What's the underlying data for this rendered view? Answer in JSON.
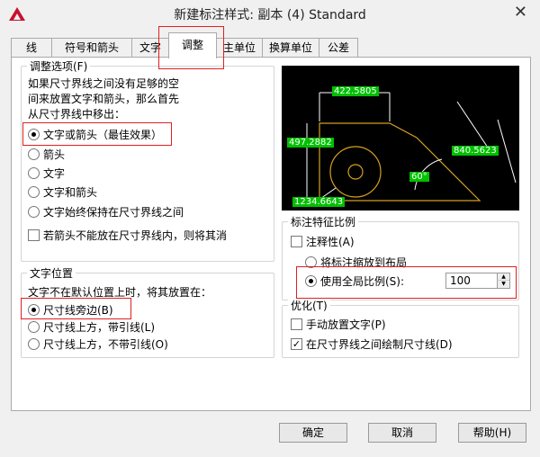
{
  "window": {
    "title": "新建标注样式: 副本 (4) Standard",
    "close_glyph": "✕",
    "logo": "autocad-logo"
  },
  "tabs": [
    "线",
    "符号和箭头",
    "文字",
    "调整",
    "主单位",
    "换算单位",
    "公差"
  ],
  "fit_options": {
    "title": "调整选项(F)",
    "description": [
      "如果尺寸界线之间没有足够的空",
      "间来放置文字和箭头，那么首先",
      "从尺寸界线中移出："
    ],
    "options": [
      "文字或箭头（最佳效果）",
      "箭头",
      "文字",
      "文字和箭头",
      "文字始终保持在尺寸界线之间"
    ],
    "selected": 0,
    "suppress_label": "若箭头不能放在尺寸界线内，则将其消"
  },
  "text_placement": {
    "title": "文字位置",
    "description": "文字不在默认位置上时，将其放置在：",
    "options": [
      "尺寸线旁边(B)",
      "尺寸线上方，带引线(L)",
      "尺寸线上方，不带引线(O)"
    ],
    "selected": 0
  },
  "preview": {
    "labels": [
      "422.5805",
      "497.2882",
      "840.5623",
      "60°",
      "1234.6643"
    ],
    "colors": {
      "background": "#000000",
      "label_bg": "#00c000",
      "geometry": "#d4a020",
      "lines": "#ffffff"
    }
  },
  "scale": {
    "title": "标注特征比例",
    "annotative_label": "注释性(A)",
    "layout_option": "将标注缩放到布局",
    "global_option": "使用全局比例(S):",
    "global_value": "100"
  },
  "finetune": {
    "title": "优化(T)",
    "manual_label": "手动放置文字(P)",
    "manual_checked": false,
    "draw_label": "在尺寸界线之间绘制尺寸线(D)",
    "draw_checked": true
  },
  "buttons": {
    "ok": "确定",
    "cancel": "取消",
    "help": "帮助(H)"
  },
  "highlight_color": "#e02020"
}
